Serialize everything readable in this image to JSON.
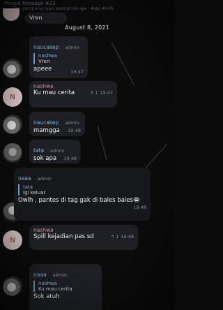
{
  "pinned": {
    "line1": "Pinned Message #22",
    "line2": "Tae gampang lyan pencet ini aja · #pp #info"
  },
  "top_partial": {
    "text": "Vren"
  },
  "date_divider": "August 8, 2021",
  "messages": [
    {
      "sender": "naucakep",
      "role": "admin",
      "quote_name": "nashwa",
      "quote_text": "Vren",
      "text": "apeee",
      "time": "19:47"
    },
    {
      "sender": "nashwa",
      "role": "",
      "text": "Ku mau cerita",
      "reply": "↰ 1",
      "time": "19:47"
    },
    {
      "sender": "naucakep",
      "role": "admin",
      "text": "mamgga",
      "time": "19:48"
    },
    {
      "sender": "tata",
      "role": "admin",
      "text": "sok apa",
      "time": "19:48"
    },
    {
      "sender": "naaa",
      "role": "admin",
      "quote_name": "tata",
      "quote_text": "Igi keluar",
      "text": "Owlh , pantes di tag gak di bales bales😭",
      "time": "19:48"
    },
    {
      "sender": "nashwa",
      "role": "",
      "text": "Spill kejadian pas sd",
      "reply": "↰ 1",
      "time": "19:48"
    },
    {
      "sender": "naaa",
      "role": "admin",
      "quote_name": "nashwa",
      "quote_text": "Ku mau cerita",
      "text": "Sok atuh",
      "time": ""
    }
  ],
  "avatars": {
    "n_letter": "N"
  }
}
